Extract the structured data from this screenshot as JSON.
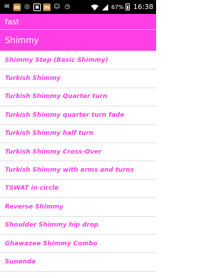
{
  "status_bar": {
    "time": "16:38",
    "battery": "67%",
    "icons": [
      "mail-icon",
      "m-app-icon",
      "circle-icon",
      "box-icon",
      "m-app-icon",
      "cat-icon",
      "clock-icon",
      "wifi-icon",
      "signal-icon",
      "battery-icon"
    ]
  },
  "search": {
    "value": "fast"
  },
  "header": {
    "title": "Shimmy"
  },
  "items": [
    "Shimmy Step (Basic Shimmy)",
    "Turkish Shimmy",
    "Turkish Shimmy Quarter turn",
    "Turkish Shimmy quarter turn fade",
    "Turkish Shimmy half turn",
    "Turkish Shimmy Cross-Over",
    "Turkish Shimmy with arms and turns",
    "TSWAT in circle",
    "Reverse Shimmy",
    "Shoulder Shimmy hip drop",
    "Ghawazee Shimmy Combo",
    "Sunanda"
  ],
  "colors": {
    "accent": "#ff3ee6",
    "status_bg": "#000000"
  }
}
